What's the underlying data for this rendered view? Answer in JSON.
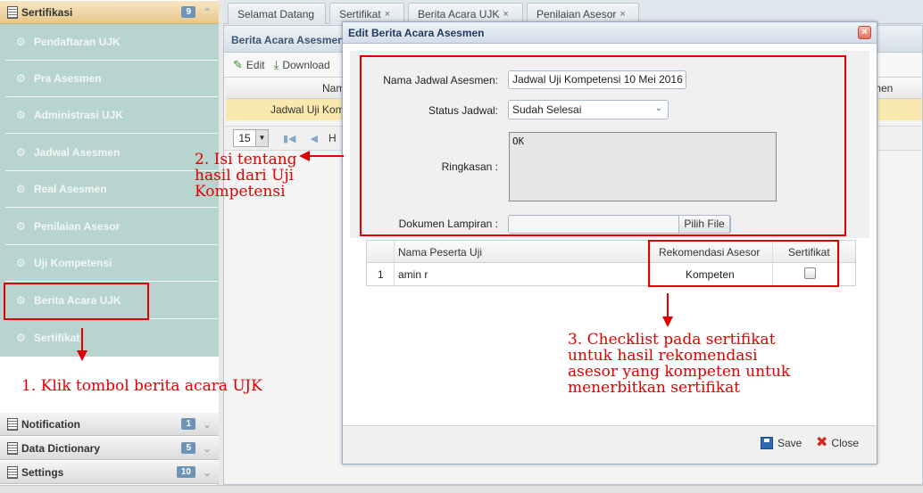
{
  "sidebar": {
    "top_header": {
      "title": "Sertifikasi",
      "badge": "9"
    },
    "menu_items": [
      {
        "label": "Pendaftaran UJK"
      },
      {
        "label": "Pra Asesmen"
      },
      {
        "label": "Administrasi UJK"
      },
      {
        "label": "Jadwal Asesmen"
      },
      {
        "label": "Real Asesmen"
      },
      {
        "label": "Penilaian Asesor"
      },
      {
        "label": "Uji Kompetensi"
      },
      {
        "label": "Berita Acara UJK"
      },
      {
        "label": "Sertifikat"
      }
    ],
    "bottom_headers": [
      {
        "title": "Notification",
        "badge": "1"
      },
      {
        "title": "Data Dictionary",
        "badge": "5"
      },
      {
        "title": "Settings",
        "badge": "10"
      }
    ]
  },
  "tabs": [
    {
      "label": "Selamat Datang",
      "closable": false
    },
    {
      "label": "Sertifikat",
      "closable": true
    },
    {
      "label": "Berita Acara UJK",
      "closable": true
    },
    {
      "label": "Penilaian Asesor",
      "closable": true
    }
  ],
  "panel": {
    "title": "Berita Acara Asesmen",
    "toolbar": {
      "edit": "Edit",
      "download": "Download"
    },
    "grid_header_left": "Nam",
    "grid_header_right": "men",
    "grid_row_text": "Jadwal Uji Kompete",
    "pager": {
      "page_size": "15",
      "text": "H"
    }
  },
  "modal": {
    "title": "Edit Berita Acara Asesmen",
    "form": {
      "nama_label": "Nama Jadwal Asesmen:",
      "nama_value": "Jadwal Uji Kompetensi 10 Mei 2016",
      "status_label": "Status Jadwal:",
      "status_value": "Sudah Selesai",
      "ringkasan_label": "Ringkasan :",
      "ringkasan_value": "OK",
      "dokumen_label": "Dokumen Lampiran :",
      "dokumen_button": "Pilih File"
    },
    "grid": {
      "headers": [
        "Nama Peserta Uji",
        "Rekomendasi Asesor",
        "Sertifikat"
      ],
      "rows": [
        {
          "no": "1",
          "nama": "amin r",
          "rekomendasi": "Kompeten",
          "sertifikat": false
        }
      ]
    },
    "footer": {
      "save": "Save",
      "close": "Close"
    }
  },
  "annotations": {
    "step1": "1. Klik tombol berita acara UJK",
    "step2": [
      "2. Isi tentang",
      "hasil dari Uji",
      "Kompetensi"
    ],
    "step3": [
      "3. Checklist pada sertifikat",
      "untuk hasil rekomendasi",
      "asesor yang kompeten untuk",
      "menerbitkan sertifikat"
    ]
  },
  "colors": {
    "annotation_red": "#e00000",
    "menu_bg": "#b8d4cf",
    "active_header": "#e8c88a"
  }
}
